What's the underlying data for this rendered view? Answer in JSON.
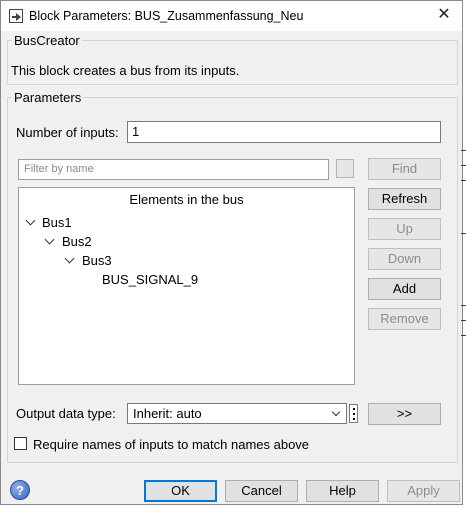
{
  "window": {
    "title": "Block Parameters: BUS_Zusammenfassung_Neu",
    "close_glyph": "✕"
  },
  "bus_creator": {
    "legend": "BusCreator",
    "description": "This block creates a bus from its inputs."
  },
  "parameters": {
    "legend": "Parameters",
    "num_inputs_label": "Number of inputs:",
    "num_inputs_value": "1",
    "filter_placeholder": "Filter by name",
    "elements_header": "Elements in the bus",
    "tree": {
      "bus1": "Bus1",
      "bus2": "Bus2",
      "bus3": "Bus3",
      "signal": "BUS_SIGNAL_9"
    },
    "buttons": {
      "find": "Find",
      "refresh": "Refresh",
      "up": "Up",
      "down": "Down",
      "add": "Add",
      "remove": "Remove"
    },
    "output_type_label": "Output data type:",
    "output_type_value": "Inherit: auto",
    "assistant_button": ">>",
    "require_names_label": "Require names of inputs to match names above",
    "require_names_checked": false
  },
  "footer": {
    "help_glyph": "?",
    "ok": "OK",
    "cancel": "Cancel",
    "help": "Help",
    "apply": "Apply"
  },
  "icons": {
    "title": "simulink-block-icon",
    "close": "close-icon",
    "help": "help-question-icon",
    "tree_expand": "chevron-down-icon",
    "dropdown": "chevron-down-icon",
    "menu": "vertical-ellipsis-icon"
  },
  "colors": {
    "dialog_bg": "#f0f0f0",
    "default_button_border": "#0078d7",
    "disabled_text": "#8c8c8c"
  }
}
